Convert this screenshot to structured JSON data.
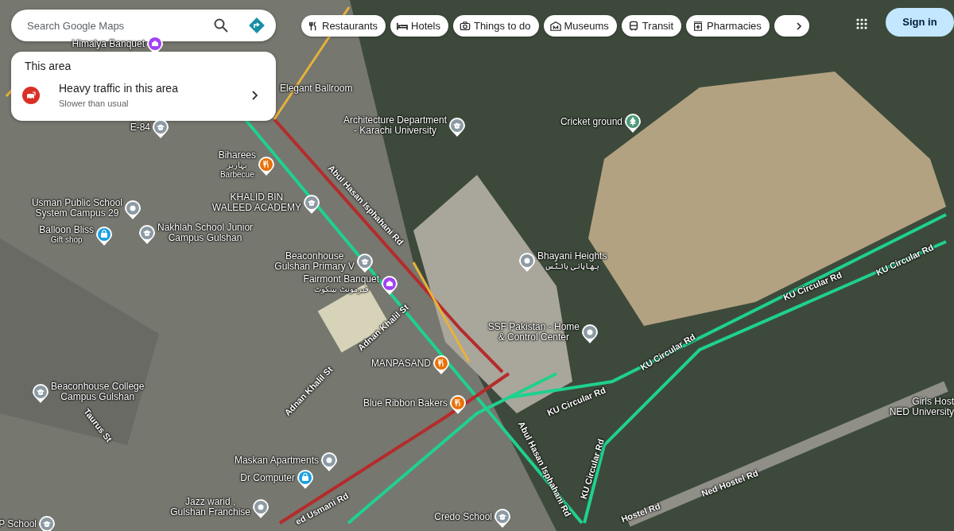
{
  "search": {
    "placeholder": "Search Google Maps"
  },
  "area_card": {
    "title": "This area",
    "item_title": "Heavy traffic in this area",
    "item_subtitle": "Slower than usual"
  },
  "chips": [
    {
      "label": "Restaurants",
      "kind": "restaurant"
    },
    {
      "label": "Hotels",
      "kind": "hotel"
    },
    {
      "label": "Things to do",
      "kind": "camera"
    },
    {
      "label": "Museums",
      "kind": "museum"
    },
    {
      "label": "Transit",
      "kind": "transit"
    },
    {
      "label": "Pharmacies",
      "kind": "pharmacy"
    }
  ],
  "sign_in": "Sign in",
  "places": [
    {
      "lines": [
        "Himalya Banquet"
      ],
      "kind": "venue"
    },
    {
      "lines": [
        "E-84"
      ],
      "kind": "school"
    },
    {
      "lines": [
        "Elegant Ballroom"
      ],
      "kind": "none"
    },
    {
      "lines": [
        "Architecture Department",
        "- Karachi University"
      ],
      "kind": "school"
    },
    {
      "lines": [
        "Cricket ground"
      ],
      "kind": "park"
    },
    {
      "lines": [
        "Biharees"
      ],
      "urdu": "بہاریز",
      "subtitle": "Barbecue",
      "kind": "restaurant"
    },
    {
      "lines": [
        "KHALID BIN",
        "WALEED ACADEMY"
      ],
      "kind": "school"
    },
    {
      "lines": [
        "Usman Public School",
        "System Campus 29"
      ],
      "kind": "place"
    },
    {
      "lines": [
        "Balloon Bliss"
      ],
      "subtitle": "Gift shop",
      "kind": "shop"
    },
    {
      "lines": [
        "Nakhlah School Junior",
        "Campus Gulshan"
      ],
      "kind": "school"
    },
    {
      "lines": [
        "Beaconhouse",
        "Gulshan Primary V"
      ],
      "kind": "school"
    },
    {
      "lines": [
        "Fairmont Banquet"
      ],
      "urdu": "فیرمونٹ بینکوٹ",
      "kind": "venue"
    },
    {
      "lines": [
        "Bhayani Heights"
      ],
      "urdu": "بھایانی ہائٹس",
      "kind": "place"
    },
    {
      "lines": [
        "SSF Pakistan - Home",
        "& Control Center"
      ],
      "kind": "place"
    },
    {
      "lines": [
        "MANPASAND"
      ],
      "kind": "restaurant"
    },
    {
      "lines": [
        "Blue Ribbon Bakers"
      ],
      "kind": "restaurant"
    },
    {
      "lines": [
        "Beaconhouse College",
        "Campus Gulshan"
      ],
      "kind": "school"
    },
    {
      "lines": [
        "Maskan Apartments"
      ],
      "kind": "place"
    },
    {
      "lines": [
        "Dr Computer"
      ],
      "kind": "shop"
    },
    {
      "lines": [
        "Jazz warid ,",
        "Gulshan Franchise"
      ],
      "kind": "place"
    },
    {
      "lines": [
        "Credo School"
      ],
      "kind": "school"
    },
    {
      "lines": [
        "P School"
      ],
      "kind": "school"
    },
    {
      "lines": [
        "Girls Host",
        "NED University"
      ],
      "kind": "none"
    }
  ],
  "roads": [
    "Abul Hasan Isphahani Rd",
    "Abul Hasan Isphahani Rd",
    "KU Circular Rd",
    "KU Circular Rd",
    "KU Circular Rd",
    "KU Circular Rd",
    "KU Circular Rd",
    "Adnan Khalil St",
    "Adnan Khalil St",
    "Taurus St",
    "ed Usmani Rd",
    "Ned Hostel Rd",
    "Hostel Rd"
  ]
}
